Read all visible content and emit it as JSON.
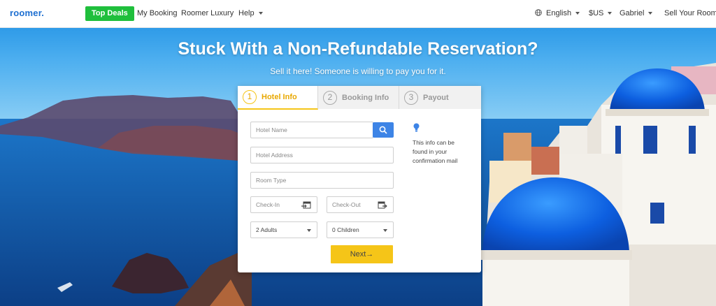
{
  "nav": {
    "logo": "roomer.",
    "top_deals": "Top Deals",
    "my_booking": "My Booking",
    "luxury": "Roomer Luxury",
    "help": "Help",
    "language": "English",
    "currency": "$US",
    "user": "Gabriel",
    "sell": "Sell Your Room"
  },
  "hero": {
    "title": "Stuck With a Non-Refundable Reservation?",
    "subtitle": "Sell it here! Someone is willing to pay you for it."
  },
  "tabs": [
    {
      "num": "1",
      "label": "Hotel Info"
    },
    {
      "num": "2",
      "label": "Booking Info"
    },
    {
      "num": "3",
      "label": "Payout"
    }
  ],
  "form": {
    "hotel_name_placeholder": "Hotel Name",
    "hotel_address_placeholder": "Hotel Address",
    "room_type_placeholder": "Room Type",
    "checkin_placeholder": "Check-In",
    "checkout_placeholder": "Check-Out",
    "adults_value": "2 Adults",
    "children_value": "0 Children",
    "next_label": "Next→",
    "info_text": "This info can be found in your confirmation mail"
  },
  "colors": {
    "brand": "#1d6fd1",
    "top_deals": "#1fbf3c",
    "accent": "#f5c518",
    "search_button": "#3d84e6"
  },
  "icons": {
    "search": "search-icon",
    "globe": "globe-icon",
    "calendar_in": "calendar-checkin-icon",
    "calendar_out": "calendar-checkout-icon",
    "info": "lightbulb-icon"
  }
}
